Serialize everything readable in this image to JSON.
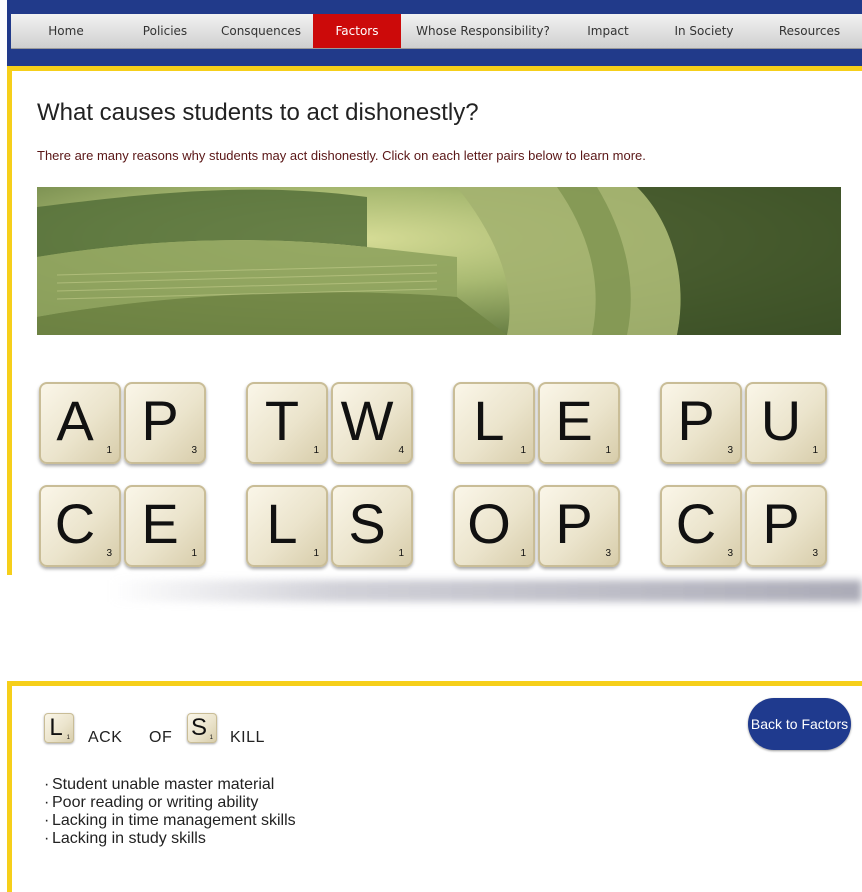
{
  "nav": {
    "items": [
      {
        "label": "Home"
      },
      {
        "label": "Policies"
      },
      {
        "label": "Consquences"
      },
      {
        "label": "Factors",
        "active": true
      },
      {
        "label": "Whose Responsibility?"
      },
      {
        "label": "Impact"
      },
      {
        "label": "In Society"
      },
      {
        "label": "Resources"
      }
    ]
  },
  "page": {
    "heading": "What causes students to act dishonestly?",
    "intro": "There are many reasons why students may act dishonestly. Click on each letter pairs below to learn more."
  },
  "letter_pairs": [
    [
      {
        "letter": "A",
        "points": "1"
      },
      {
        "letter": "P",
        "points": "3"
      }
    ],
    [
      {
        "letter": "T",
        "points": "1"
      },
      {
        "letter": "W",
        "points": "4"
      }
    ],
    [
      {
        "letter": "L",
        "points": "1"
      },
      {
        "letter": "E",
        "points": "1"
      }
    ],
    [
      {
        "letter": "P",
        "points": "3"
      },
      {
        "letter": "U",
        "points": "1"
      }
    ],
    [
      {
        "letter": "C",
        "points": "3"
      },
      {
        "letter": "E",
        "points": "1"
      }
    ],
    [
      {
        "letter": "L",
        "points": "1"
      },
      {
        "letter": "S",
        "points": "1"
      }
    ],
    [
      {
        "letter": "O",
        "points": "1"
      },
      {
        "letter": "P",
        "points": "3"
      }
    ],
    [
      {
        "letter": "C",
        "points": "3"
      },
      {
        "letter": "P",
        "points": "3"
      }
    ]
  ],
  "detail": {
    "tile1": {
      "letter": "L",
      "points": "1"
    },
    "word1": "ACK",
    "word_of": "OF",
    "tile2": {
      "letter": "S",
      "points": "1"
    },
    "word2": "KILL",
    "back_button": "Back to Factors",
    "bullets": [
      "Student unable master material",
      "Poor reading or writing ability",
      "Lacking in time management skills",
      "Lacking in study skills"
    ]
  },
  "colors": {
    "nav_band": "#213a8a",
    "active_tab": "#cc0a0a",
    "frame": "#f6cf1a",
    "button": "#1f3a8e"
  }
}
